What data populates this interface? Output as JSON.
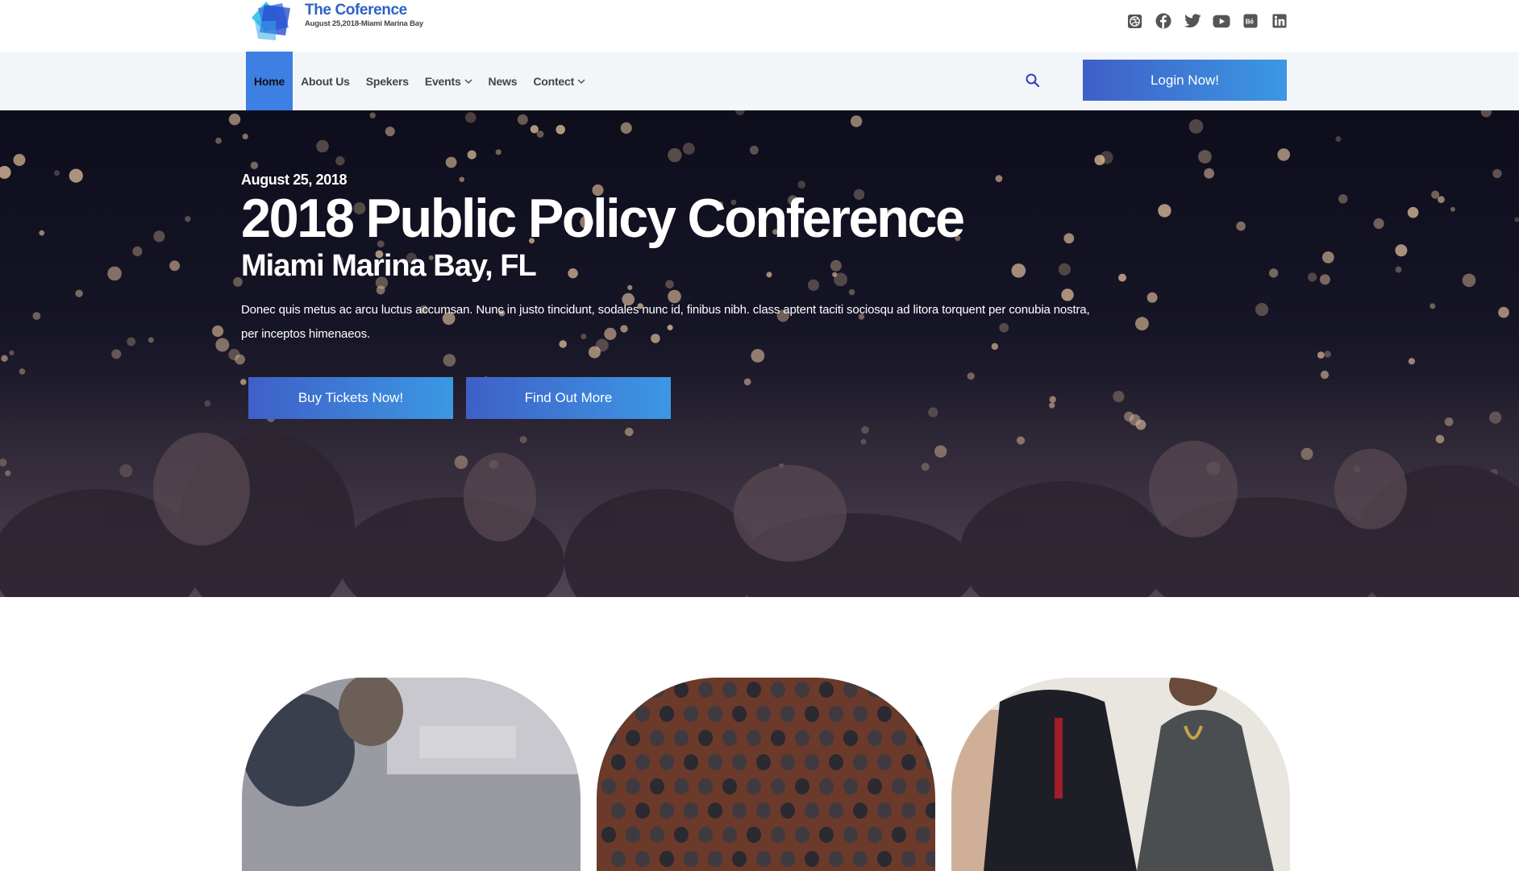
{
  "brand": {
    "title": "The Coference",
    "subtitle": "August 25,2018-Miami Marina Bay"
  },
  "social_icons": [
    "dribbble-icon",
    "facebook-icon",
    "twitter-icon",
    "youtube-icon",
    "behance-icon",
    "linkedin-icon"
  ],
  "nav": {
    "items": [
      {
        "label": "Home",
        "active": true
      },
      {
        "label": "About Us"
      },
      {
        "label": "Spekers"
      },
      {
        "label": "Events",
        "dropdown": true
      },
      {
        "label": "News"
      },
      {
        "label": "Contect",
        "dropdown": true
      }
    ],
    "login_label": "Login Now!"
  },
  "hero": {
    "date": "August 25, 2018",
    "title": "2018 Public Policy Conference",
    "location": "Miami Marina Bay, FL",
    "description": "Donec quis metus ac arcu luctus accumsan. Nunc in justo tincidunt, sodales nunc id, finibus nibh. class aptent taciti sociosqu ad litora torquent per conubia nostra, per inceptos himenaeos.",
    "buy_label": "Buy Tickets Now!",
    "more_label": "Find Out More"
  },
  "colors": {
    "brand_blue": "#2d62c8",
    "active_nav": "#3d7fe2",
    "button_gradient_start": "#3f5fc8",
    "button_gradient_end": "#3c98e3",
    "nav_bg": "#f3f6f9"
  }
}
